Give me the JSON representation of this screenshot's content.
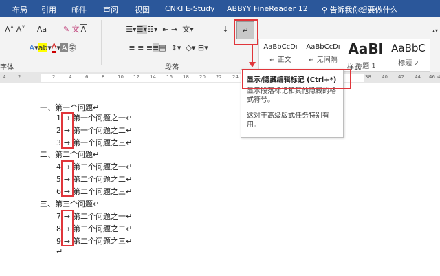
{
  "tabs": [
    "布局",
    "引用",
    "邮件",
    "审阅",
    "视图",
    "CNKI E-Study",
    "ABBYY FineReader 12"
  ],
  "tell_me": "告诉我你想要做什么",
  "ribbon": {
    "font_group_label": "字体",
    "paragraph_group_label": "段落",
    "styles_group_label": "样式",
    "font_size_label": "Aa",
    "styles": [
      {
        "preview": "AaBbCcDı",
        "name": "↵ 正文"
      },
      {
        "preview": "AaBbCcDı",
        "name": "↵ 无间隔"
      },
      {
        "preview": "AaBl",
        "name": "标题 1"
      },
      {
        "preview": "AaBbC",
        "name": "标题 2"
      }
    ]
  },
  "ruler": [
    "4",
    "2",
    "2",
    "4",
    "6",
    "8",
    "10",
    "12",
    "14",
    "16",
    "18",
    "20",
    "22",
    "24",
    "38",
    "40",
    "42",
    "44",
    "46",
    "48"
  ],
  "tooltip": {
    "title": "显示/隐藏编辑标记 (Ctrl+*)",
    "desc1": "显示段落标记和其他隐藏的格式符号。",
    "desc2": "这对于高级版式任务特别有用。"
  },
  "document": {
    "lines": [
      {
        "text": "一、第一个问题↵",
        "level": 0
      },
      {
        "num": "1",
        "text": "第一个问题之一↵",
        "level": 1
      },
      {
        "num": "2",
        "text": "第一个问题之二↵",
        "level": 1
      },
      {
        "num": "3",
        "text": "第一个问题之三↵",
        "level": 1
      },
      {
        "text": "二、第二个问题↵",
        "level": 0
      },
      {
        "num": "4",
        "text": "第二个问题之一↵",
        "level": 1
      },
      {
        "num": "5",
        "text": "第二个问题之二↵",
        "level": 1
      },
      {
        "num": "6",
        "text": "第二个问题之三↵",
        "level": 1
      },
      {
        "text": "三、第三个问题↵",
        "level": 0
      },
      {
        "num": "7",
        "text": "第二个问题之一↵",
        "level": 1
      },
      {
        "num": "8",
        "text": "第二个问题之二↵",
        "level": 1
      },
      {
        "num": "9",
        "text": "第二个问题之三↵",
        "level": 1
      },
      {
        "text": "↵",
        "level": 1
      }
    ],
    "tab_mark": "→"
  },
  "colors": {
    "tabbar": "#2b579a",
    "highlight": "#e0363b"
  }
}
